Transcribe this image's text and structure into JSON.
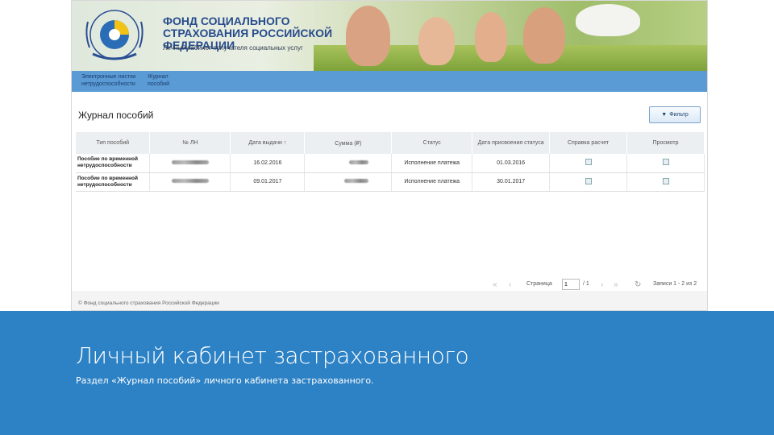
{
  "portal": {
    "org_title": "ФОНД СОЦИАЛЬНОГО СТРАХОВАНИЯ РОССИЙСКОЙ ФЕДЕРАЦИИ",
    "org_subtitle": "Личный кабинет получателя социальных услуг",
    "nav": [
      {
        "label": "Электронные листки нетрудоспособности"
      },
      {
        "label": "Журнал пособий"
      }
    ]
  },
  "main": {
    "page_title": "Журнал пособий",
    "filter_label": "Фильтр",
    "columns": [
      "Тип пособий",
      "№ ЛН",
      "Дата выдачи ↑",
      "Сумма (₽)",
      "Статус",
      "Дата присвоения статуса",
      "Справка расчет",
      "Просмотр"
    ],
    "rows": [
      {
        "type": "Пособие по временной нетрудоспособности",
        "issue_date": "16.02.2016",
        "status": "Исполнение платежа",
        "status_date": "01.03.2016"
      },
      {
        "type": "Пособие по временной нетрудоспособности",
        "issue_date": "09.01.2017",
        "status": "Исполнение платежа",
        "status_date": "30.01.2017"
      }
    ]
  },
  "pager": {
    "page_label": "Страница",
    "page_value": "1",
    "of_total": "/ 1",
    "records": "Записи 1 - 2 из 2"
  },
  "footer": {
    "copyright": "© Фонд социального страхования Российской Федерации"
  },
  "slide": {
    "title": "Личный кабинет застрахованного",
    "subtitle": "Раздел «Журнал пособий» личного кабинета застрахованного."
  },
  "colors": {
    "band": "#2d82c5",
    "nav": "#5b9bd5",
    "brand_text": "#274b8c"
  },
  "icons": [
    "fss-logo-icon",
    "filter-icon",
    "first-page-icon",
    "prev-page-icon",
    "next-page-icon",
    "last-page-icon",
    "refresh-icon",
    "document-icon"
  ]
}
